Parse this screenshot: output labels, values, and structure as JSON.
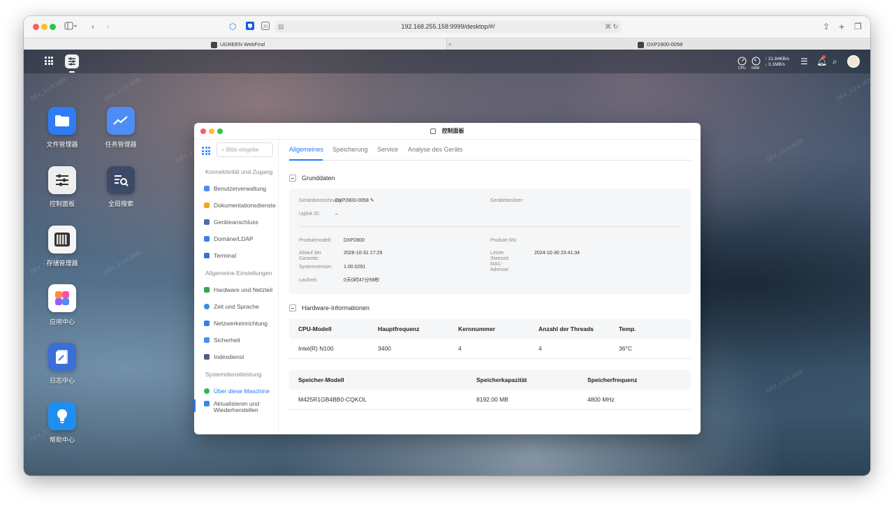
{
  "browser": {
    "url": "192.168.255.158:9999/desktop/#/",
    "tabs": [
      {
        "label": "UGREEN WebFind"
      },
      {
        "label": "DXP2800-0058"
      }
    ]
  },
  "tray": {
    "cpu_label": "CPU",
    "ram_label": "RAM",
    "upload": "↑ 21.84KB/s",
    "download": "↓ 3.1MB/s"
  },
  "watermark": "DEV_1.0.0.1826",
  "desktop_icons": [
    {
      "label": "文件管理器",
      "icon": "folder-icon",
      "color": "#2f7cf6"
    },
    {
      "label": "任务管理器",
      "icon": "chart-icon",
      "color": "#4e8df5"
    },
    {
      "label": "控制面板",
      "icon": "sliders-icon",
      "color": "#eeeeee"
    },
    {
      "label": "全局搜索",
      "icon": "search-icon",
      "color": "#3d4a66"
    },
    {
      "label": "存储管理器",
      "icon": "storage-icon",
      "color": "#f4f4f4"
    },
    {
      "label": "应用中心",
      "icon": "apps-icon",
      "color": "#ffffff"
    },
    {
      "label": "日志中心",
      "icon": "log-icon",
      "color": "#3a6fd8"
    },
    {
      "label": "帮助中心",
      "icon": "bulb-icon",
      "color": "#1f8ef1"
    }
  ],
  "control_panel": {
    "title": "控制面板",
    "search_placeholder": "Bitte eingebe",
    "groups": [
      {
        "label": "Konnektivität und Zugang"
      },
      {
        "label": "Allgemeine Einstellungen"
      },
      {
        "label": "Systemdienstleistung"
      }
    ],
    "items": [
      {
        "label": "Benutzerverwaltung",
        "color": "#4a8df6"
      },
      {
        "label": "Dokumentationsdienste",
        "color": "#f5a623"
      },
      {
        "label": "Geräteanschluss",
        "color": "#4a6fa5"
      },
      {
        "label": "Domäne/LDAP",
        "color": "#3b7de8"
      },
      {
        "label": "Terminal",
        "color": "#3b6fd8"
      },
      {
        "label": "Hardware und Netzteil",
        "color": "#34a853"
      },
      {
        "label": "Zeit und Sprache",
        "color": "#2f8cf0"
      },
      {
        "label": "Netzwerkeinrichtung",
        "color": "#3b7de8"
      },
      {
        "label": "Sicherheit",
        "color": "#4a8df6"
      },
      {
        "label": "Indexdienst",
        "color": "#4a5f8a"
      },
      {
        "label": "Über diese Maschine",
        "color": "#2fb55a"
      },
      {
        "label": "Aktualisieren und Wiederherstellen",
        "color": "#2f8cf0"
      }
    ],
    "tabs": [
      {
        "label": "Allgemeines"
      },
      {
        "label": "Speicherung"
      },
      {
        "label": "Service"
      },
      {
        "label": "Analyse des Geräts"
      }
    ],
    "grunddaten": {
      "heading": "Grunddaten",
      "device_name_key": "Gerätsbezeichnung",
      "device_name_value": "DXP2800-0058",
      "owner_key": "Gerätebesitzer:",
      "uglink_key": "Uglink ID:",
      "uglink_value": "–",
      "model_key": "Produktmodell:",
      "model_value": "DXP2800",
      "sn_key": "Produkt-SN:",
      "warranty_key": "Ablauf der Garantie:",
      "warranty_value": "2026-10-31 17:29",
      "last_start_key": "Letzte Startzeit:",
      "last_start_value": "2024-10-30 23:41:34",
      "sysver_key": "Systemversion:",
      "sysver_value": "1.00.0291",
      "mac_key": "MAC-Adresse:",
      "uptime_key": "Laufzeit:",
      "uptime_value": "0天0时47分59秒"
    },
    "hardware": {
      "heading": "Hardware-Informationen",
      "cpu_headers": [
        "CPU-Modell",
        "Hauptfrequenz",
        "Kernnummer",
        "Anzahl der Threads",
        "Temp."
      ],
      "cpu_row": [
        "Intel(R) N100",
        "3400",
        "4",
        "4",
        "36°C"
      ],
      "mem_headers": [
        "Speicher-Modell",
        "Speicherkapazität",
        "Speicherfrequenz"
      ],
      "mem_row": [
        "M425R1GB4BB0-CQKOL",
        "8192.00 MB",
        "4800 MHz"
      ]
    }
  }
}
